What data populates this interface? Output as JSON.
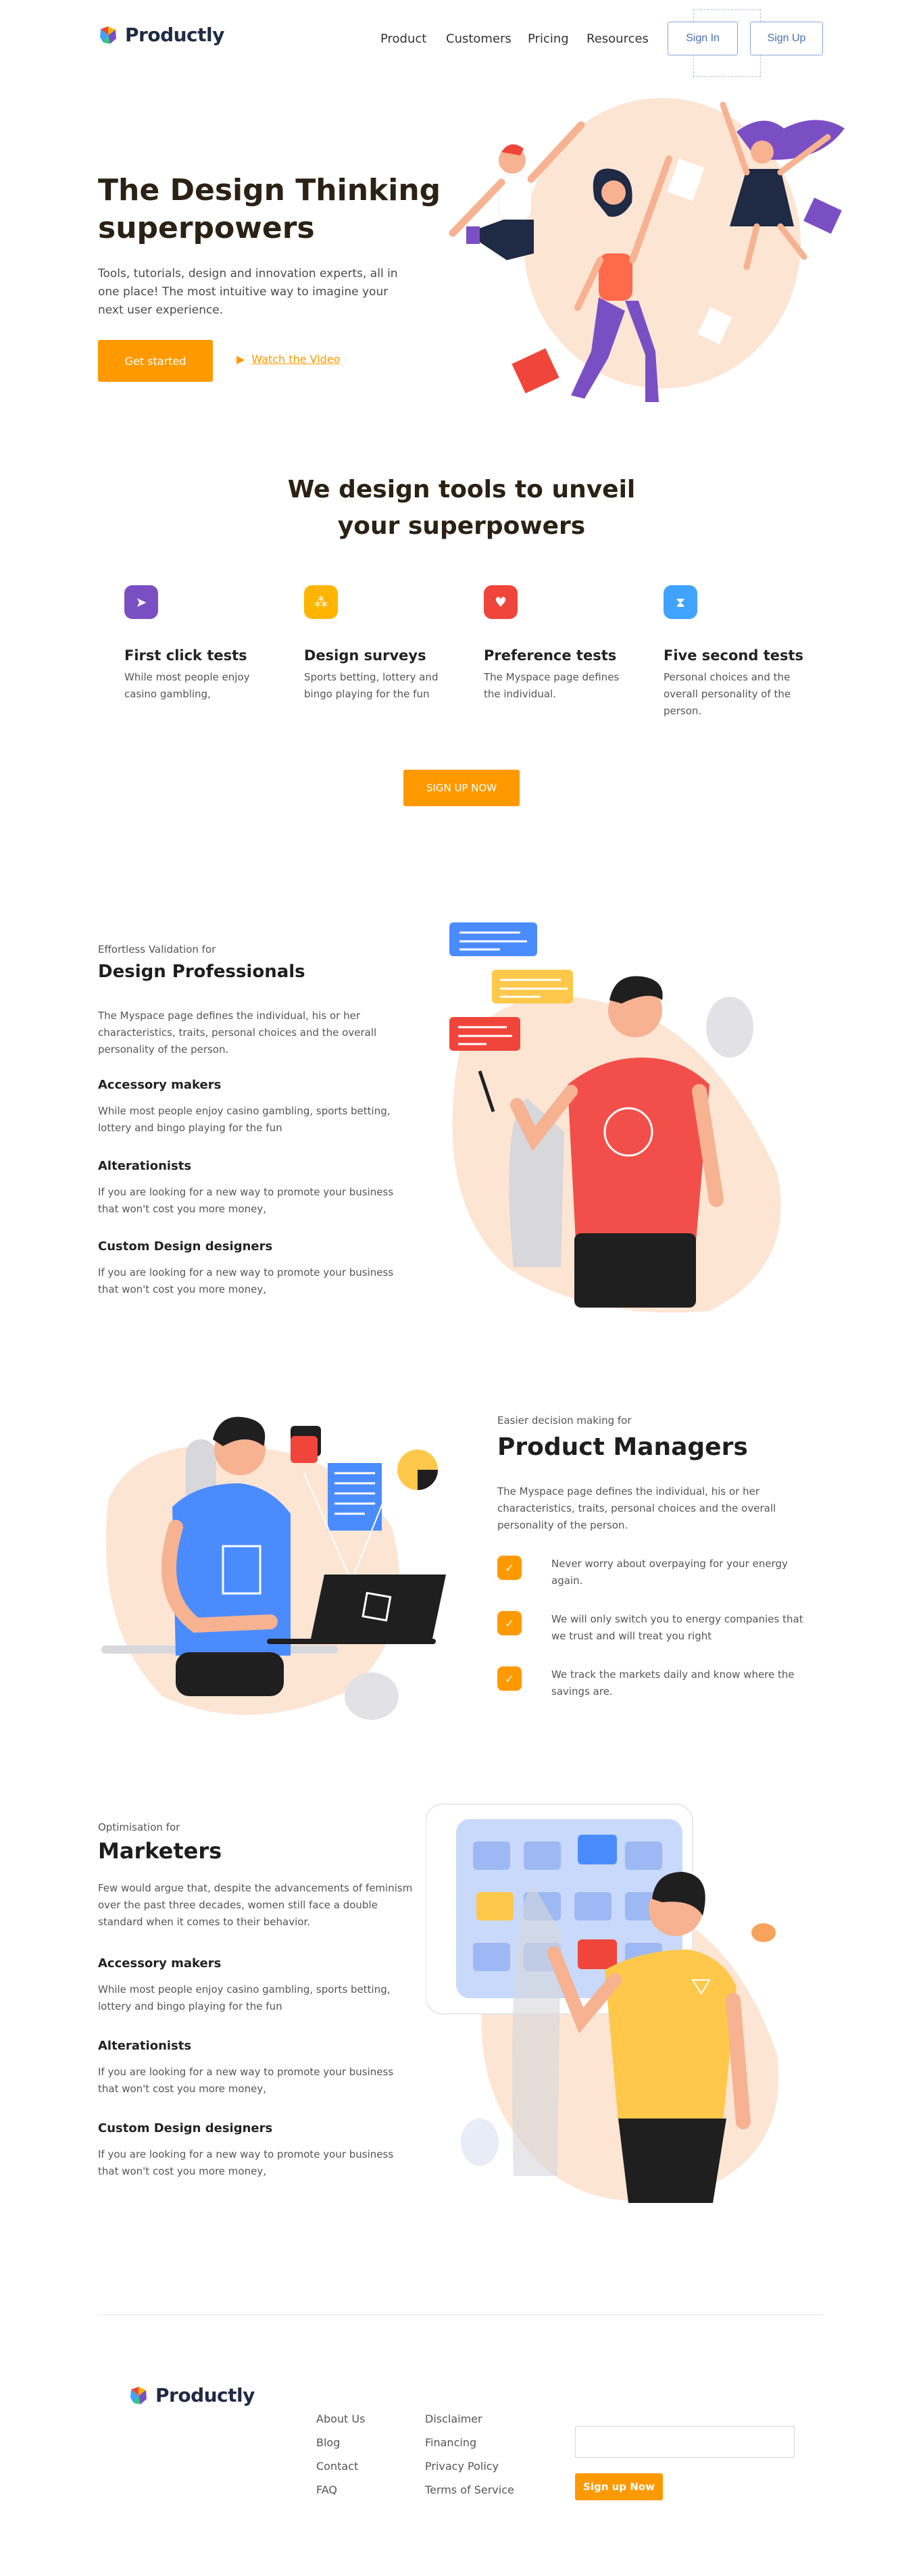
{
  "brand": {
    "name": "Productly"
  },
  "nav": {
    "links": [
      "Product",
      "Customers",
      "Pricing",
      "Resources"
    ],
    "sign_in": "Sign In",
    "sign_up": "Sign Up"
  },
  "hero": {
    "title_line1": "The Design Thinking",
    "title_line2": "superpowers",
    "description": "Tools, tutorials, design and innovation experts, all in one place! The most intuitive way to imagine your next user experience.",
    "cta": "Get started",
    "video_link": "Watch the Video"
  },
  "features": {
    "title_line1": "We design tools to unveil",
    "title_line2": "your superpowers",
    "items": [
      {
        "title": "First click tests",
        "text": "While most people enjoy casino gambling,",
        "color": "#7b4fc4",
        "icon": "cursor-icon"
      },
      {
        "title": "Design surveys",
        "text": "Sports betting, lottery and bingo playing for the fun",
        "color": "#ffb400",
        "icon": "survey-icon"
      },
      {
        "title": "Preference tests",
        "text": "The Myspace page defines the individual.",
        "color": "#f0453a",
        "icon": "heart-icon"
      },
      {
        "title": "Five second tests",
        "text": "Personal choices and the overall personality of the person.",
        "color": "#3fa3ff",
        "icon": "timer-icon"
      }
    ],
    "cta": "SIGN UP NOW"
  },
  "design_pros": {
    "eyebrow": "Effortless Validation for",
    "title": "Design Professionals",
    "intro": "The Myspace page defines the individual, his or her characteristics, traits, personal choices and the overall personality of the person.",
    "items": [
      {
        "title": "Accessory makers",
        "text": "While most people enjoy casino gambling, sports betting, lottery and bingo playing for the fun"
      },
      {
        "title": "Alterationists",
        "text": "If you are looking for a new way to promote your business that won't cost you more money,"
      },
      {
        "title": "Custom Design designers",
        "text": "If you are looking for a new way to promote your business that won't cost you more money,"
      }
    ]
  },
  "product_managers": {
    "eyebrow": "Easier decision making for",
    "title": "Product Managers",
    "intro": "The Myspace page defines the individual, his or her characteristics, traits, personal choices and the overall personality of the person.",
    "checks": [
      "Never worry about overpaying for your energy again.",
      "We will only switch you to energy companies that we trust and will treat you right",
      "We track the markets daily and know where the savings are."
    ]
  },
  "marketers": {
    "eyebrow": "Optimisation for",
    "title": "Marketers",
    "intro": "Few would argue that, despite the advancements of feminism over the past three decades, women still face a double standard when it comes to their behavior.",
    "items": [
      {
        "title": "Accessory makers",
        "text": "While most people enjoy casino gambling, sports betting, lottery and bingo playing for the fun"
      },
      {
        "title": "Alterationists",
        "text": "If you are looking for a new way to promote your business that won't cost you more money,"
      },
      {
        "title": "Custom Design designers",
        "text": "If you are looking for a new way to promote your business that won't cost you more money,"
      }
    ]
  },
  "footer": {
    "col1": [
      "About Us",
      "Blog",
      "Contact",
      "FAQ"
    ],
    "col2": [
      "Disclaimer",
      "Financing",
      "Privacy Policy",
      "Terms of Service"
    ],
    "email_placeholder": "",
    "cta": "Sign up Now"
  },
  "colors": {
    "accent": "#ff9900",
    "brand_dark": "#1f2a44",
    "outline": "#8aa4d6"
  }
}
